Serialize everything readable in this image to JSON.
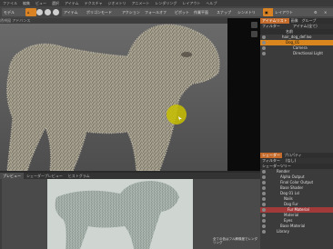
{
  "menubar": [
    "ファイル",
    "編集",
    "ビュー",
    "選択",
    "アイテム",
    "テクスチャ",
    "ジオメトリ",
    "アニメート",
    "レンダリング",
    "レイアウト",
    "ヘルプ"
  ],
  "toolbar": {
    "left_label": "モデル",
    "item_label": "アイテム",
    "polygon_label": "ポリゴンモード",
    "mode_label": "アクション",
    "falloff_label": "フォールオフ",
    "pivot_label": "ピボット",
    "workspace_label": "作業平面",
    "snap_label": "スナップ",
    "symmetry_label": "シンメトリ",
    "right_label": "レイアウト"
  },
  "viewport": {
    "header": "透視図  アドバンス  ",
    "accent": "#c8c000"
  },
  "items_panel": {
    "tabs": [
      "アイテムリスト",
      "画像",
      "グループ"
    ],
    "filter_label": "フィルター",
    "filter_value": "アイテム(全て)",
    "column_label": "名前",
    "items": [
      {
        "label": "hair_dog_def.lxo",
        "state": "normal"
      },
      {
        "label": "Dog_01",
        "state": "selected"
      },
      {
        "label": "Camera",
        "state": "normal"
      },
      {
        "label": "Directional Light",
        "state": "normal"
      }
    ]
  },
  "shader_panel": {
    "tabs": [
      "シェーダー",
      "プロパティ"
    ],
    "filter_label": "フィルター",
    "filter_value": "(なし)",
    "view_label": "シェーダーツリー",
    "items": [
      {
        "label": "Render",
        "state": "normal"
      },
      {
        "label": "Alpha Output",
        "state": "normal"
      },
      {
        "label": "Final Color Output",
        "state": "normal"
      },
      {
        "label": "Base Shader",
        "state": "normal"
      },
      {
        "label": "Dog 01 Lsl",
        "state": "normal"
      },
      {
        "label": "Nails",
        "state": "normal"
      },
      {
        "label": "Dog Fur",
        "state": "normal"
      },
      {
        "label": "Fur Material",
        "state": "highlight"
      },
      {
        "label": "Material",
        "state": "normal"
      },
      {
        "label": "Eyes",
        "state": "normal"
      },
      {
        "label": "Base Material",
        "state": "normal"
      },
      {
        "label": "Library",
        "state": "normal"
      }
    ]
  },
  "bottom": {
    "tabs": [
      "プレビュー",
      "シェーダープレビュー",
      "ヒストグラム"
    ],
    "preview_status": "全ての色はフル解像度でレンダリング"
  },
  "colors": {
    "accent_orange": "#d98324",
    "selection_red": "#a23a3a",
    "cursor_yellow": "#c8c000"
  }
}
